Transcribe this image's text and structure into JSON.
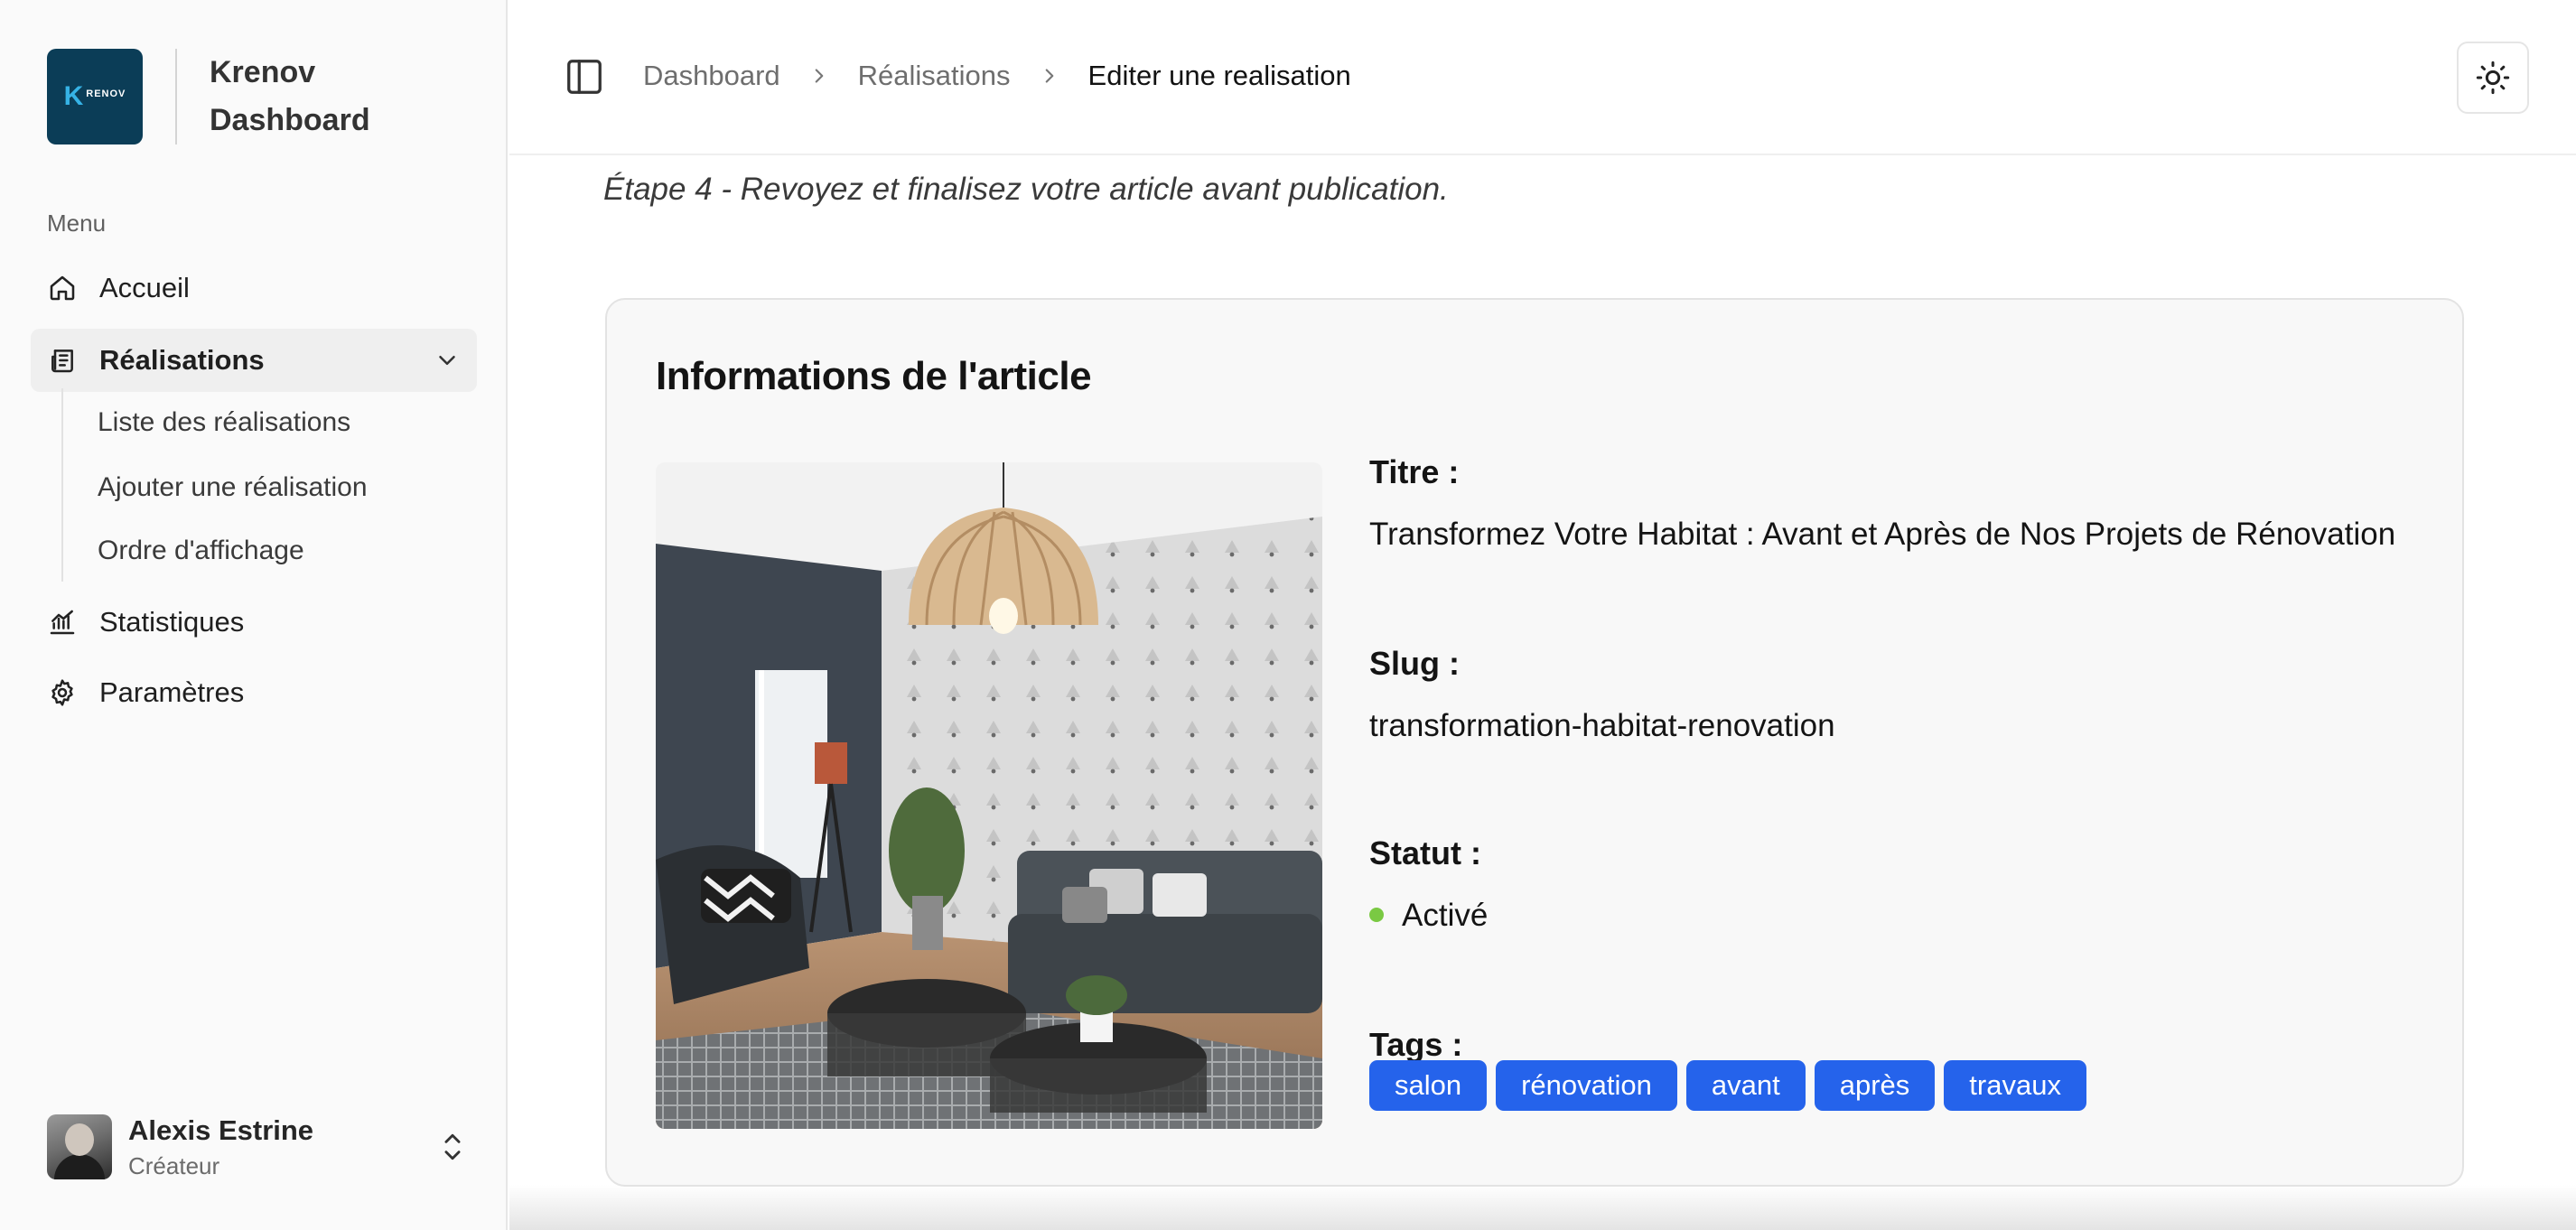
{
  "brand": {
    "logo_text": "RENOV",
    "name_line1": "Krenov",
    "name_line2": "Dashboard"
  },
  "sidebar": {
    "menu_label": "Menu",
    "items": [
      {
        "label": "Accueil",
        "icon": "home-icon"
      },
      {
        "label": "Réalisations",
        "icon": "newspaper-icon",
        "active": true,
        "children": [
          {
            "label": "Liste des réalisations"
          },
          {
            "label": "Ajouter une réalisation"
          },
          {
            "label": "Ordre d'affichage"
          }
        ]
      },
      {
        "label": "Statistiques",
        "icon": "chart-icon"
      },
      {
        "label": "Paramètres",
        "icon": "gear-icon"
      }
    ]
  },
  "user": {
    "name": "Alexis Estrine",
    "role": "Créateur"
  },
  "breadcrumb": [
    "Dashboard",
    "Réalisations",
    "Editer une realisation"
  ],
  "main": {
    "step_text": "Étape 4 - Revoyez et finalisez votre article avant publication.",
    "card_title": "Informations de l'article",
    "fields": {
      "title_label": "Titre :",
      "title_value": "Transformez Votre Habitat : Avant et Après de Nos Projets de Rénovation",
      "slug_label": "Slug :",
      "slug_value": "transformation-habitat-renovation",
      "status_label": "Statut :",
      "status_value": "Activé",
      "tags_label": "Tags :"
    },
    "tags": [
      "salon",
      "rénovation",
      "avant",
      "après",
      "travaux"
    ]
  },
  "colors": {
    "accent": "#2563eb",
    "status_active": "#7ac943",
    "logo_bg": "#0b3d57"
  }
}
